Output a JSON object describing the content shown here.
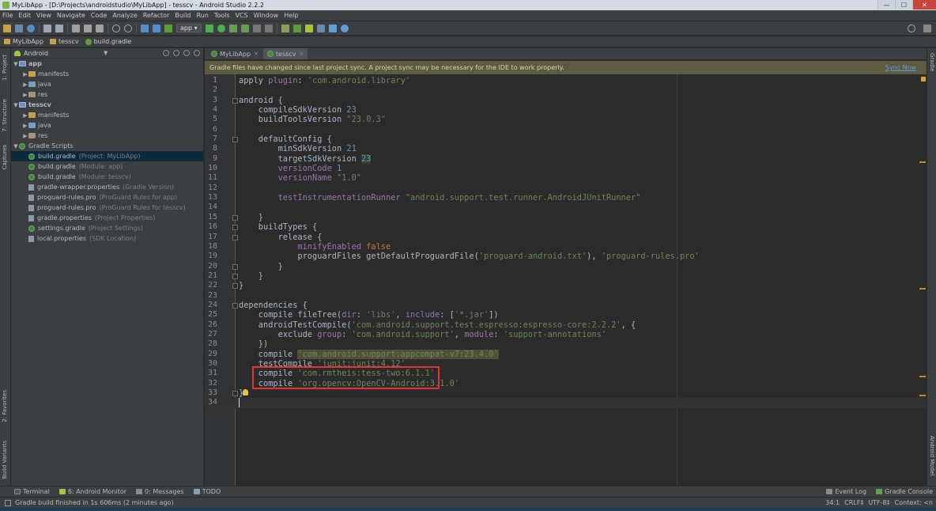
{
  "window": {
    "title": "MyLibApp - [D:\\Projects\\androidstudio\\MyLibApp] - tesscv - Android Studio 2.2.2",
    "min": "—",
    "max": "☐",
    "close": "✕"
  },
  "menu": [
    "File",
    "Edit",
    "View",
    "Navigate",
    "Code",
    "Analyze",
    "Refactor",
    "Build",
    "Run",
    "Tools",
    "VCS",
    "Window",
    "Help"
  ],
  "toolbar": {
    "run_config": "app ▾"
  },
  "breadcrumb": [
    "MyLibApp",
    "tesscv",
    "build.gradle"
  ],
  "left_strip": {
    "project": "1: Project",
    "structure": "7: Structure",
    "captures": "Captures",
    "favorites": "2: Favorites",
    "variants": "Build Variants"
  },
  "right_strip": {
    "gradle": "Gradle",
    "android_model": "Android Model"
  },
  "project_panel": {
    "view": "Android",
    "tree": [
      {
        "arrow": "▼",
        "label": "app",
        "sub": "",
        "kind": "module",
        "indent": 0
      },
      {
        "arrow": "▶",
        "label": "manifests",
        "sub": "",
        "kind": "folder",
        "indent": 1
      },
      {
        "arrow": "▶",
        "label": "java",
        "sub": "",
        "kind": "folder",
        "indent": 1
      },
      {
        "arrow": "▶",
        "label": "res",
        "sub": "",
        "kind": "folder",
        "indent": 1
      },
      {
        "arrow": "▼",
        "label": "tesscv",
        "sub": "",
        "kind": "module",
        "indent": 0
      },
      {
        "arrow": "▶",
        "label": "manifests",
        "sub": "",
        "kind": "folder",
        "indent": 1
      },
      {
        "arrow": "▶",
        "label": "java",
        "sub": "",
        "kind": "folder",
        "indent": 1
      },
      {
        "arrow": "▶",
        "label": "res",
        "sub": "",
        "kind": "folder",
        "indent": 1
      },
      {
        "arrow": "▼",
        "label": "Gradle Scripts",
        "sub": "",
        "kind": "gradle",
        "indent": 0
      },
      {
        "arrow": "",
        "label": "build.gradle",
        "sub": "(Project: MyLibApp)",
        "kind": "gradle",
        "indent": 1,
        "selected": true
      },
      {
        "arrow": "",
        "label": "build.gradle",
        "sub": "(Module: app)",
        "kind": "gradle",
        "indent": 1
      },
      {
        "arrow": "",
        "label": "build.gradle",
        "sub": "(Module: tesscv)",
        "kind": "gradle",
        "indent": 1
      },
      {
        "arrow": "",
        "label": "gradle-wrapper.properties",
        "sub": "(Gradle Version)",
        "kind": "file",
        "indent": 1
      },
      {
        "arrow": "",
        "label": "proguard-rules.pro",
        "sub": "(ProGuard Rules for app)",
        "kind": "file",
        "indent": 1
      },
      {
        "arrow": "",
        "label": "proguard-rules.pro",
        "sub": "(ProGuard Rules for tesscv)",
        "kind": "file",
        "indent": 1
      },
      {
        "arrow": "",
        "label": "gradle.properties",
        "sub": "(Project Properties)",
        "kind": "file",
        "indent": 1
      },
      {
        "arrow": "",
        "label": "settings.gradle",
        "sub": "(Project Settings)",
        "kind": "gradle",
        "indent": 1
      },
      {
        "arrow": "",
        "label": "local.properties",
        "sub": "(SDK Location)",
        "kind": "file",
        "indent": 1
      }
    ]
  },
  "tabs": [
    {
      "label": "MyLibApp",
      "close": "×",
      "active": false
    },
    {
      "label": "tesscv",
      "close": "×",
      "active": true
    }
  ],
  "notification": {
    "message": "Gradle files have changed since last project sync. A project sync may be necessary for the IDE to work properly.",
    "action": "Sync Now"
  },
  "code_lines": [
    [
      [
        "apply ",
        "p"
      ],
      [
        "plugin",
        "prop"
      ],
      [
        ": ",
        "p"
      ],
      [
        "'com.android.library'",
        "str"
      ]
    ],
    [],
    [
      [
        "android {",
        "p"
      ]
    ],
    [
      [
        "    compileSdkVersion ",
        "p"
      ],
      [
        "23",
        "num"
      ]
    ],
    [
      [
        "    buildToolsVersion ",
        "p"
      ],
      [
        "\"23.0.3\"",
        "str"
      ]
    ],
    [],
    [
      [
        "    defaultConfig {",
        "p"
      ]
    ],
    [
      [
        "        minSdkVersion ",
        "p"
      ],
      [
        "21",
        "num"
      ]
    ],
    [
      [
        "        targetSdkVersion ",
        "p"
      ],
      [
        "23",
        "hlnum"
      ]
    ],
    [
      [
        "        versionCode ",
        "prop"
      ],
      [
        "1",
        "num"
      ]
    ],
    [
      [
        "        versionName ",
        "prop"
      ],
      [
        "\"1.0\"",
        "str"
      ]
    ],
    [],
    [
      [
        "        testInstrumentationRunner ",
        "prop"
      ],
      [
        "\"android.support.test.runner.AndroidJUnitRunner\"",
        "str"
      ]
    ],
    [],
    [
      [
        "    }",
        "p"
      ]
    ],
    [
      [
        "    buildTypes {",
        "p"
      ]
    ],
    [
      [
        "        release {",
        "p"
      ]
    ],
    [
      [
        "            minifyEnabled ",
        "prop"
      ],
      [
        "false",
        "kw"
      ]
    ],
    [
      [
        "            proguardFiles getDefaultProguardFile(",
        "p"
      ],
      [
        "'proguard-android.txt'",
        "str"
      ],
      [
        "), ",
        "p"
      ],
      [
        "'proguard-rules.pro'",
        "str"
      ]
    ],
    [
      [
        "        }",
        "p"
      ]
    ],
    [
      [
        "    }",
        "p"
      ]
    ],
    [
      [
        "}",
        "p"
      ]
    ],
    [],
    [
      [
        "dependencies {",
        "p"
      ]
    ],
    [
      [
        "    compile fileTree(",
        "p"
      ],
      [
        "dir",
        "prop"
      ],
      [
        ": ",
        "p"
      ],
      [
        "'libs'",
        "str"
      ],
      [
        ", ",
        "p"
      ],
      [
        "include",
        "prop"
      ],
      [
        ": [",
        "p"
      ],
      [
        "'*.jar'",
        "str"
      ],
      [
        "])",
        "p"
      ]
    ],
    [
      [
        "    androidTestCompile(",
        "p"
      ],
      [
        "'com.android.support.test.espresso:espresso-core:2.2.2'",
        "str"
      ],
      [
        ", {",
        "p"
      ]
    ],
    [
      [
        "        exclude ",
        "p"
      ],
      [
        "group",
        "prop"
      ],
      [
        ": ",
        "p"
      ],
      [
        "'com.android.support'",
        "str"
      ],
      [
        ", ",
        "p"
      ],
      [
        "module",
        "prop"
      ],
      [
        ": ",
        "p"
      ],
      [
        "'support-annotations'",
        "str"
      ]
    ],
    [
      [
        "    })",
        "p"
      ]
    ],
    [
      [
        "    compile ",
        "p"
      ],
      [
        "'com.android.support:appcompat-v7:23.4.0'",
        "hl"
      ]
    ],
    [
      [
        "    testCompile ",
        "p"
      ],
      [
        "'junit:junit:4.12'",
        "str"
      ]
    ],
    [
      [
        "    compile ",
        "p"
      ],
      [
        "'com.rmtheis:tess-two:6.1.1'",
        "str"
      ]
    ],
    [
      [
        "    compile ",
        "p"
      ],
      [
        "'org.opencv:OpenCV-Android:3.1.0'",
        "str"
      ]
    ],
    [
      [
        "}",
        "p"
      ]
    ],
    []
  ],
  "bottom_tools": [
    "Terminal",
    "6: Android Monitor",
    "0: Messages",
    "TODO"
  ],
  "bottom_right": [
    "Event Log",
    "Gradle Console"
  ],
  "status": {
    "message": "Gradle build finished in 1s 606ms (2 minutes ago)",
    "position": "34:1",
    "line_sep": "CRLF‡",
    "encoding": "UTF-8‡",
    "context": "Context: <n"
  },
  "colors": {
    "keyword": "#cc7832",
    "string": "#6a8759",
    "number": "#6897bb",
    "property": "#9876aa",
    "highlight_box": "#e03535"
  }
}
